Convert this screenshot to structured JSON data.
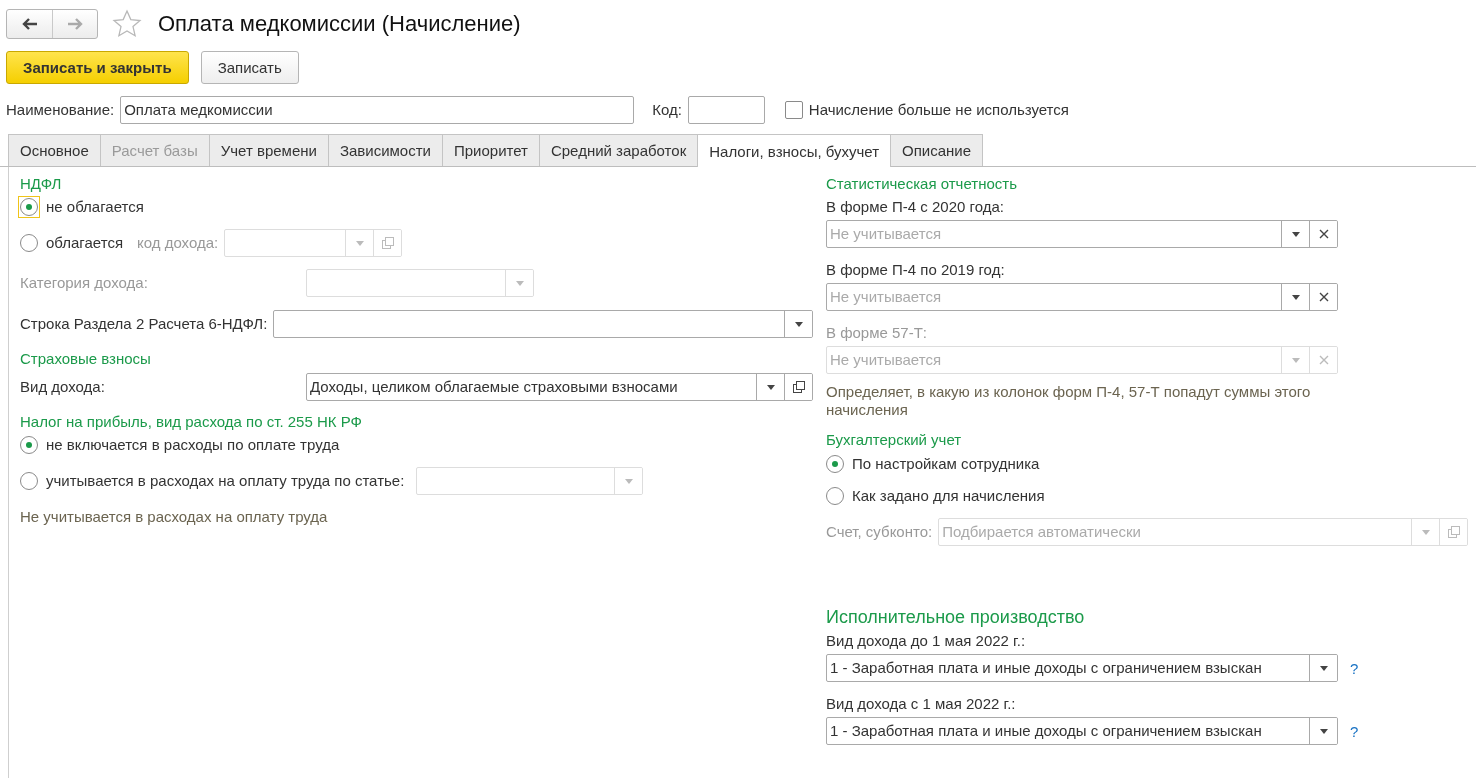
{
  "window": {
    "title": "Оплата медкомиссии (Начисление)",
    "favorite": false
  },
  "toolbar": {
    "buttons": [
      {
        "label": "Записать и закрыть",
        "kind": "primary"
      },
      {
        "label": "Записать",
        "kind": "default"
      }
    ]
  },
  "header_fields": {
    "name": {
      "label": "Наименование:",
      "value": "Оплата медкомиссии"
    },
    "code": {
      "label": "Код:"
    },
    "not_used": {
      "label": "Начисление больше не используется",
      "checked": false
    }
  },
  "tabs": [
    {
      "label": "Основное",
      "selected": false,
      "disabled": false
    },
    {
      "label": "Расчет базы",
      "selected": false,
      "disabled": true
    },
    {
      "label": "Учет времени",
      "selected": false,
      "disabled": false
    },
    {
      "label": "Зависимости",
      "selected": false,
      "disabled": false
    },
    {
      "label": "Приоритет",
      "selected": false,
      "disabled": false
    },
    {
      "label": "Средний заработок",
      "selected": false,
      "disabled": false
    },
    {
      "label": "Налоги, взносы, бухучет",
      "selected": true,
      "disabled": false
    },
    {
      "label": "Описание",
      "selected": false,
      "disabled": false
    }
  ],
  "ndfl": {
    "heading": "НДФЛ",
    "options": [
      {
        "label": "не облагается",
        "selected": true,
        "focused": true
      },
      {
        "label": "облагается",
        "selected": false,
        "focused": false
      }
    ],
    "income_code": {
      "label": "код дохода:",
      "disabled": true,
      "buttons": [
        {
          "kind": "dropdown"
        },
        {
          "kind": "open"
        }
      ]
    },
    "income_category": {
      "label": "Категория дохода:",
      "disabled": true,
      "buttons": [
        {
          "kind": "dropdown"
        }
      ]
    },
    "report_line": {
      "label": "Строка Раздела 2 Расчета 6-НДФЛ:",
      "disabled": false,
      "buttons": [
        {
          "kind": "dropdown"
        }
      ]
    }
  },
  "insurance": {
    "heading": "Страховые взносы",
    "income_type": {
      "label": "Вид дохода:",
      "value": "Доходы, целиком облагаемые страховыми взносами",
      "disabled": false,
      "buttons": [
        {
          "kind": "dropdown"
        },
        {
          "kind": "open"
        }
      ]
    }
  },
  "profit_tax": {
    "heading": "Налог на прибыль, вид расхода по ст. 255 НК РФ",
    "options": [
      {
        "label": "не включается в расходы по оплате труда",
        "selected": true,
        "focused": false
      },
      {
        "label": "учитывается в расходах на оплату труда по статье:",
        "selected": false,
        "focused": false
      }
    ],
    "article": {
      "disabled": true,
      "buttons": [
        {
          "kind": "dropdown"
        }
      ]
    },
    "note": "Не учитывается в расходах на оплату труда"
  },
  "statistics": {
    "heading": "Статистическая отчетность",
    "fields": [
      {
        "label": "В форме П-4 с 2020 года:",
        "placeholder": "Не учитывается",
        "disabled": false,
        "buttons": [
          {
            "kind": "dropdown"
          },
          {
            "kind": "clear"
          }
        ]
      },
      {
        "label": "В форме П-4 по 2019 год:",
        "placeholder": "Не учитывается",
        "disabled": false,
        "buttons": [
          {
            "kind": "dropdown"
          },
          {
            "kind": "clear"
          }
        ]
      },
      {
        "label": "В форме 57-Т:",
        "placeholder": "Не учитывается",
        "disabled": true,
        "buttons": [
          {
            "kind": "dropdown"
          },
          {
            "kind": "clear"
          }
        ]
      }
    ],
    "note": "Определяет, в какую из колонок форм П-4, 57-Т попадут суммы этого начисления"
  },
  "accounting": {
    "heading": "Бухгалтерский учет",
    "options": [
      {
        "label": "По настройкам сотрудника",
        "selected": true,
        "focused": false
      },
      {
        "label": "Как задано для начисления",
        "selected": false,
        "focused": false
      }
    ],
    "account": {
      "label": "Счет, субконто:",
      "placeholder": "Подбирается автоматически",
      "disabled": true,
      "buttons": [
        {
          "kind": "dropdown"
        },
        {
          "kind": "open"
        }
      ]
    }
  },
  "enforcement": {
    "heading": "Исполнительное производство",
    "fields": [
      {
        "label": "Вид дохода до 1 мая 2022 г.:",
        "value": "1 - Заработная плата и иные доходы с ограничением взыскан",
        "disabled": false,
        "help": "?",
        "buttons": [
          {
            "kind": "dropdown"
          }
        ]
      },
      {
        "label": "Вид дохода с 1 мая 2022 г.:",
        "value": "1 - Заработная плата и иные доходы с ограничением взыскан",
        "disabled": false,
        "help": "?",
        "buttons": [
          {
            "kind": "dropdown"
          }
        ]
      }
    ]
  }
}
